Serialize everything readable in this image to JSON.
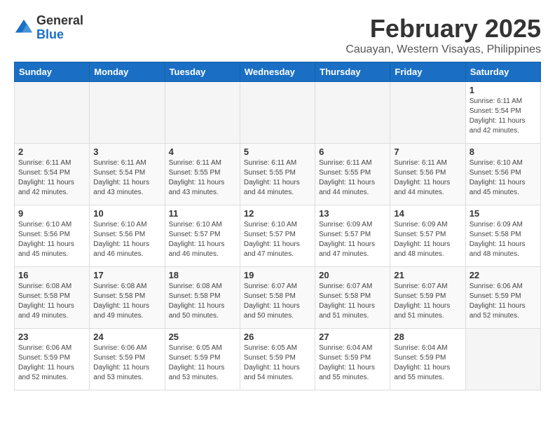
{
  "header": {
    "logo_general": "General",
    "logo_blue": "Blue",
    "month_year": "February 2025",
    "location": "Cauayan, Western Visayas, Philippines"
  },
  "weekdays": [
    "Sunday",
    "Monday",
    "Tuesday",
    "Wednesday",
    "Thursday",
    "Friday",
    "Saturday"
  ],
  "weeks": [
    [
      {
        "day": "",
        "info": ""
      },
      {
        "day": "",
        "info": ""
      },
      {
        "day": "",
        "info": ""
      },
      {
        "day": "",
        "info": ""
      },
      {
        "day": "",
        "info": ""
      },
      {
        "day": "",
        "info": ""
      },
      {
        "day": "1",
        "info": "Sunrise: 6:11 AM\nSunset: 5:54 PM\nDaylight: 11 hours and 42 minutes."
      }
    ],
    [
      {
        "day": "2",
        "info": "Sunrise: 6:11 AM\nSunset: 5:54 PM\nDaylight: 11 hours and 42 minutes."
      },
      {
        "day": "3",
        "info": "Sunrise: 6:11 AM\nSunset: 5:54 PM\nDaylight: 11 hours and 43 minutes."
      },
      {
        "day": "4",
        "info": "Sunrise: 6:11 AM\nSunset: 5:55 PM\nDaylight: 11 hours and 43 minutes."
      },
      {
        "day": "5",
        "info": "Sunrise: 6:11 AM\nSunset: 5:55 PM\nDaylight: 11 hours and 44 minutes."
      },
      {
        "day": "6",
        "info": "Sunrise: 6:11 AM\nSunset: 5:55 PM\nDaylight: 11 hours and 44 minutes."
      },
      {
        "day": "7",
        "info": "Sunrise: 6:11 AM\nSunset: 5:56 PM\nDaylight: 11 hours and 44 minutes."
      },
      {
        "day": "8",
        "info": "Sunrise: 6:10 AM\nSunset: 5:56 PM\nDaylight: 11 hours and 45 minutes."
      }
    ],
    [
      {
        "day": "9",
        "info": "Sunrise: 6:10 AM\nSunset: 5:56 PM\nDaylight: 11 hours and 45 minutes."
      },
      {
        "day": "10",
        "info": "Sunrise: 6:10 AM\nSunset: 5:56 PM\nDaylight: 11 hours and 46 minutes."
      },
      {
        "day": "11",
        "info": "Sunrise: 6:10 AM\nSunset: 5:57 PM\nDaylight: 11 hours and 46 minutes."
      },
      {
        "day": "12",
        "info": "Sunrise: 6:10 AM\nSunset: 5:57 PM\nDaylight: 11 hours and 47 minutes."
      },
      {
        "day": "13",
        "info": "Sunrise: 6:09 AM\nSunset: 5:57 PM\nDaylight: 11 hours and 47 minutes."
      },
      {
        "day": "14",
        "info": "Sunrise: 6:09 AM\nSunset: 5:57 PM\nDaylight: 11 hours and 48 minutes."
      },
      {
        "day": "15",
        "info": "Sunrise: 6:09 AM\nSunset: 5:58 PM\nDaylight: 11 hours and 48 minutes."
      }
    ],
    [
      {
        "day": "16",
        "info": "Sunrise: 6:08 AM\nSunset: 5:58 PM\nDaylight: 11 hours and 49 minutes."
      },
      {
        "day": "17",
        "info": "Sunrise: 6:08 AM\nSunset: 5:58 PM\nDaylight: 11 hours and 49 minutes."
      },
      {
        "day": "18",
        "info": "Sunrise: 6:08 AM\nSunset: 5:58 PM\nDaylight: 11 hours and 50 minutes."
      },
      {
        "day": "19",
        "info": "Sunrise: 6:07 AM\nSunset: 5:58 PM\nDaylight: 11 hours and 50 minutes."
      },
      {
        "day": "20",
        "info": "Sunrise: 6:07 AM\nSunset: 5:58 PM\nDaylight: 11 hours and 51 minutes."
      },
      {
        "day": "21",
        "info": "Sunrise: 6:07 AM\nSunset: 5:59 PM\nDaylight: 11 hours and 51 minutes."
      },
      {
        "day": "22",
        "info": "Sunrise: 6:06 AM\nSunset: 5:59 PM\nDaylight: 11 hours and 52 minutes."
      }
    ],
    [
      {
        "day": "23",
        "info": "Sunrise: 6:06 AM\nSunset: 5:59 PM\nDaylight: 11 hours and 52 minutes."
      },
      {
        "day": "24",
        "info": "Sunrise: 6:06 AM\nSunset: 5:59 PM\nDaylight: 11 hours and 53 minutes."
      },
      {
        "day": "25",
        "info": "Sunrise: 6:05 AM\nSunset: 5:59 PM\nDaylight: 11 hours and 53 minutes."
      },
      {
        "day": "26",
        "info": "Sunrise: 6:05 AM\nSunset: 5:59 PM\nDaylight: 11 hours and 54 minutes."
      },
      {
        "day": "27",
        "info": "Sunrise: 6:04 AM\nSunset: 5:59 PM\nDaylight: 11 hours and 55 minutes."
      },
      {
        "day": "28",
        "info": "Sunrise: 6:04 AM\nSunset: 5:59 PM\nDaylight: 11 hours and 55 minutes."
      },
      {
        "day": "",
        "info": ""
      }
    ]
  ]
}
